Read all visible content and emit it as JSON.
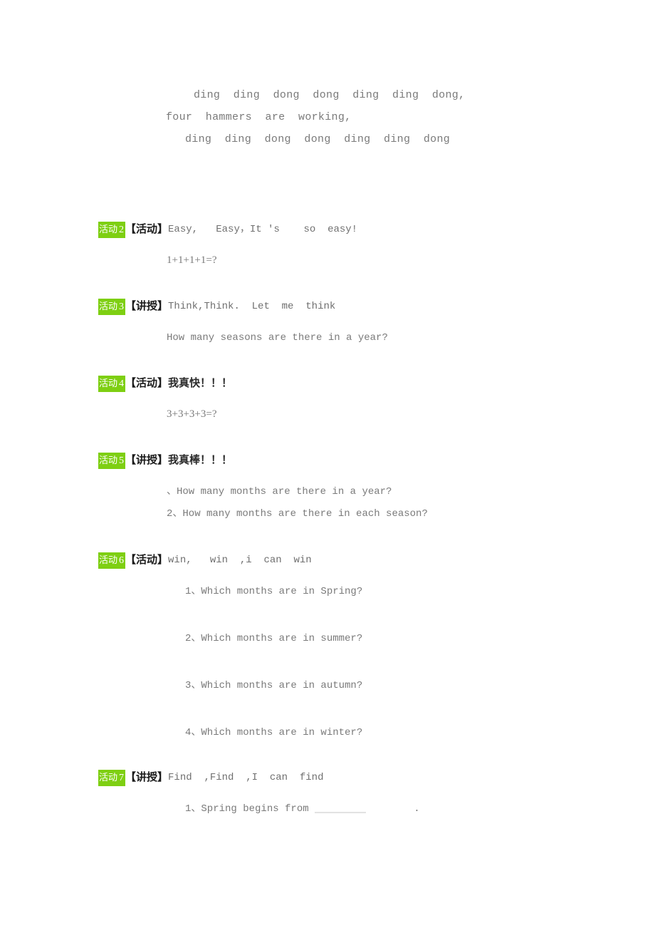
{
  "document": {
    "background_color": "#ffffff",
    "text_color": "#7a7a7a",
    "accent_color": "#7ECF12"
  },
  "chant": {
    "lines": [
      "ding  ding  dong  dong  ding  ding  dong,",
      "four  hammers  are  working,",
      "ding  ding  dong  dong  ding  ding  dong"
    ]
  },
  "activities": [
    {
      "tag_label": "活动",
      "number": "2",
      "kind": "【活动】",
      "title": "Easy,   Easy，It 's    so  easy!",
      "title_is_chinese": false,
      "lines": [
        {
          "text": "1+1+1+1=?",
          "style": "math",
          "indent": 96
        }
      ]
    },
    {
      "tag_label": "活动",
      "number": "3",
      "kind": "【讲授】",
      "title": "Think,Think.  Let  me  think",
      "title_is_chinese": false,
      "lines": [
        {
          "text": "How many seasons are there in a year?",
          "style": "mono",
          "indent": 96
        }
      ]
    },
    {
      "tag_label": "活动",
      "number": "4",
      "kind": "【活动】",
      "title": "我真快！！！",
      "title_is_chinese": true,
      "lines": [
        {
          "text": "3+3+3+3=?",
          "style": "math",
          "indent": 96
        }
      ]
    },
    {
      "tag_label": "活动",
      "number": "5",
      "kind": "【讲授】",
      "title": "我真棒！！！",
      "title_is_chinese": true,
      "lines": [
        {
          "text": "、How many months are there in a year?",
          "style": "mono",
          "indent": 96
        },
        {
          "text": "2、How many months are there in each season?",
          "style": "mono",
          "indent": 96
        }
      ]
    },
    {
      "tag_label": "活动",
      "number": "6",
      "kind": "【活动】",
      "title": "win,   win  ,i  can  win",
      "title_is_chinese": false,
      "lines": [
        {
          "text": "1、Which months are in Spring?",
          "style": "mono",
          "indent": 122
        },
        {
          "text": "2、Which months are in summer?",
          "style": "mono",
          "indent": 122
        },
        {
          "text": "3、Which months are in autumn?",
          "style": "mono",
          "indent": 122
        },
        {
          "text": "4、Which months are in winter?",
          "style": "mono",
          "indent": 122
        }
      ]
    },
    {
      "tag_label": "活动",
      "number": "7",
      "kind": "【讲授】",
      "title": "Find  ,Find  ,I  can  find",
      "title_is_chinese": false,
      "lines": [
        {
          "text": "1、Spring begins from ",
          "style": "mono",
          "indent": 122,
          "blank_after": true,
          "text_after": "        ."
        }
      ]
    }
  ]
}
